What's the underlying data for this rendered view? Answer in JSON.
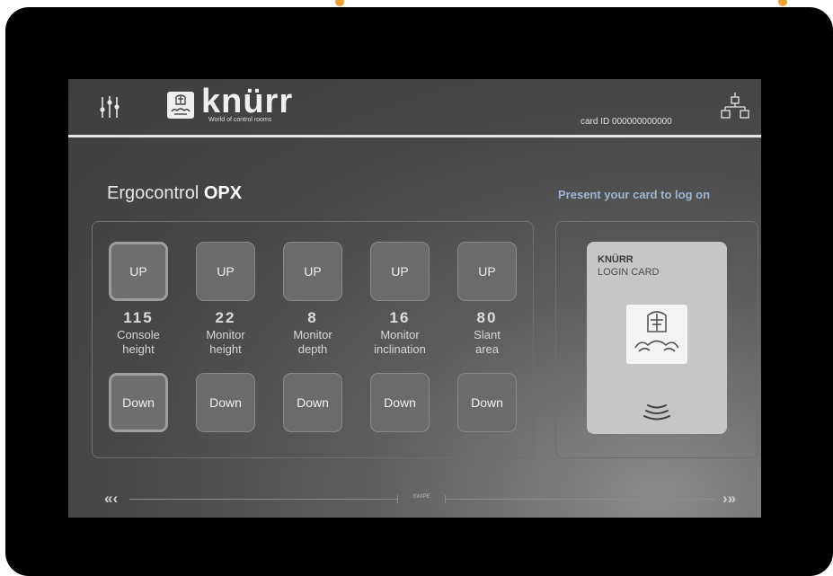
{
  "header": {
    "brand": "knürr",
    "tagline": "World of control rooms",
    "card_id": "card ID 000000000000"
  },
  "page": {
    "title_prefix": "Ergocontrol",
    "title_bold": "OPX",
    "login_prompt": "Present your card to log on"
  },
  "controls": [
    {
      "up": "UP",
      "down": "Down",
      "value": "115",
      "label_1": "Console",
      "label_2": "height"
    },
    {
      "up": "UP",
      "down": "Down",
      "value": "22",
      "label_1": "Monitor",
      "label_2": "height"
    },
    {
      "up": "UP",
      "down": "Down",
      "value": "8",
      "label_1": "Monitor",
      "label_2": "depth"
    },
    {
      "up": "UP",
      "down": "Down",
      "value": "16",
      "label_1": "Monitor",
      "label_2": "inclination"
    },
    {
      "up": "UP",
      "down": "Down",
      "value": "80",
      "label_1": "Slant",
      "label_2": "area"
    }
  ],
  "card": {
    "title": "KNÜRR",
    "subtitle": "LOGIN CARD"
  },
  "swipe": {
    "label": "SWIPE",
    "left_arrows": "«‹",
    "right_arrows": "›»"
  },
  "colors": {
    "accent_orange": "#f0a030",
    "prompt_blue": "#9fb6d2",
    "bezel": "#000000"
  },
  "icons": [
    "sliders-icon",
    "knight-logo-icon",
    "network-icon",
    "knight-emblem-icon",
    "contactless-icon",
    "double-chevron-left-icon",
    "double-chevron-right-icon"
  ]
}
